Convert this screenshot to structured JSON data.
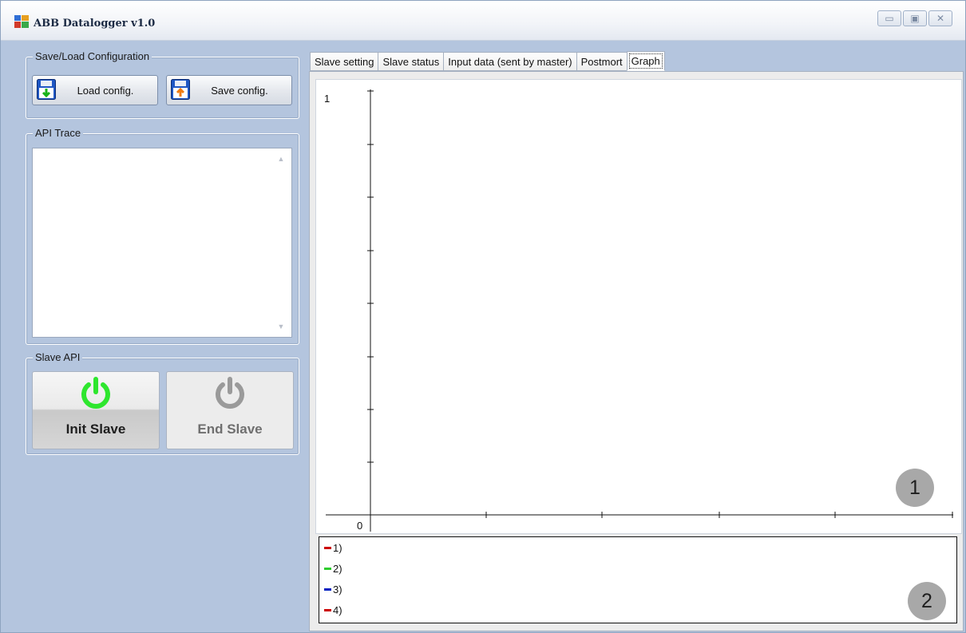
{
  "window": {
    "title": "ABB Datalogger v1.0",
    "controls": [
      "minimize",
      "maximize",
      "close"
    ]
  },
  "save_load": {
    "title": "Save/Load Configuration",
    "load_label": "Load config.",
    "save_label": "Save config.",
    "load_icon": "floppy-load-icon",
    "save_icon": "floppy-save-icon"
  },
  "api_trace": {
    "title": "API Trace",
    "content": ""
  },
  "slave_api": {
    "title": "Slave API",
    "init_label": "Init Slave",
    "end_label": "End Slave",
    "init_color": "#2ee62e",
    "end_color": "#9a9a9a"
  },
  "tabs": [
    {
      "label": "Slave setting"
    },
    {
      "label": "Slave status"
    },
    {
      "label": "Input data (sent by master)"
    },
    {
      "label": "Postmort"
    },
    {
      "label": "Graph",
      "active": true
    }
  ],
  "chart_data": {
    "type": "line",
    "ylim": [
      0,
      1
    ],
    "yticks_labeled": [
      "1",
      "0"
    ],
    "series": [
      {
        "name": "1)",
        "color": "#cc0000",
        "values": []
      },
      {
        "name": "2)",
        "color": "#2ecc2e",
        "values": []
      },
      {
        "name": "3)",
        "color": "#0020c0",
        "values": []
      },
      {
        "name": "4)",
        "color": "#cc0000",
        "values": []
      }
    ],
    "grid": false,
    "legend": "bottom"
  },
  "callouts": [
    "1",
    "2"
  ]
}
